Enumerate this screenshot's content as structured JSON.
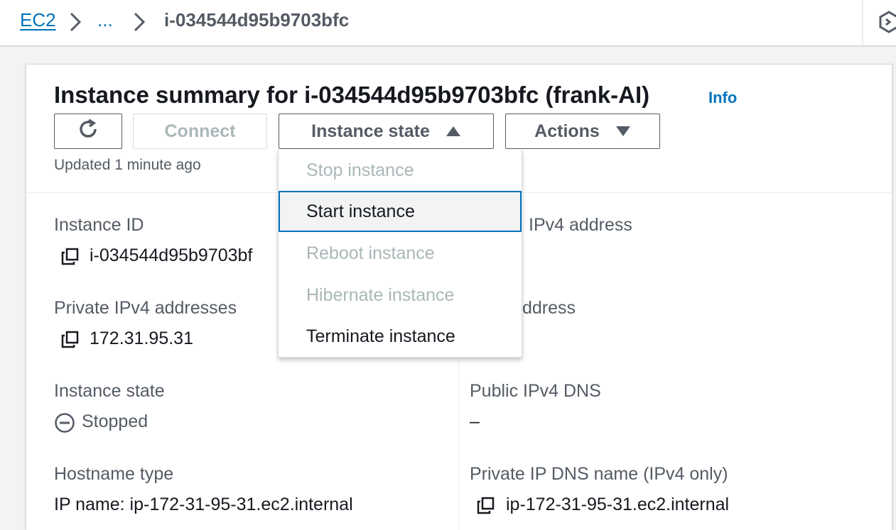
{
  "breadcrumb": {
    "root": "EC2",
    "ellipsis": "...",
    "current": "i-034544d95b9703bfc"
  },
  "summary": {
    "title": "Instance summary for i-034544d95b9703bfc (frank-AI)",
    "info": "Info",
    "updated": "Updated 1 minute ago"
  },
  "toolbar": {
    "refresh_icon": "refresh-icon",
    "connect": "Connect",
    "instance_state": "Instance state",
    "actions": "Actions"
  },
  "dropdown": {
    "items": [
      {
        "label": "Stop instance",
        "enabled": false
      },
      {
        "label": "Start instance",
        "enabled": true
      },
      {
        "label": "Reboot instance",
        "enabled": false
      },
      {
        "label": "Hibernate instance",
        "enabled": false
      },
      {
        "label": "Terminate instance",
        "enabled": true
      }
    ]
  },
  "details": {
    "instance_id_label": "Instance ID",
    "instance_id_value": "i-034544d95b9703bf",
    "public_ipv4_label": "IPv4 address",
    "private_ipv4_label": "Private IPv4 addresses",
    "private_ipv4_value": "172.31.95.31",
    "ipv6_label": "ddress",
    "instance_state_label": "Instance state",
    "instance_state_value": "Stopped",
    "public_dns_label": "Public IPv4 DNS",
    "public_dns_value": "–",
    "hostname_type_label": "Hostname type",
    "hostname_type_value": "IP name: ip-172-31-95-31.ec2.internal",
    "private_dns_label": "Private IP DNS name (IPv4 only)",
    "private_dns_value": "ip-172-31-95-31.ec2.internal"
  },
  "colors": {
    "link": "#0073bb",
    "text": "#16191f",
    "muted": "#545b64",
    "disabled": "#aab7b8",
    "border": "#d5dbdb"
  }
}
